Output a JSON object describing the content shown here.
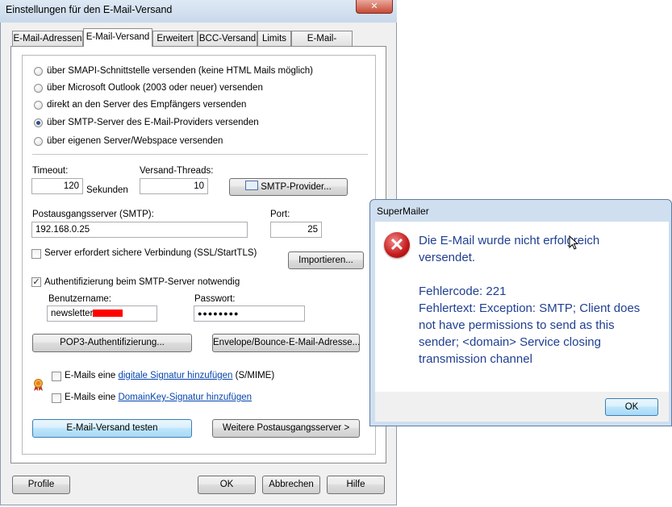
{
  "window": {
    "title": "Einstellungen für den E-Mail-Versand",
    "close_label": "✕"
  },
  "tabs": [
    {
      "label": "E-Mail-Adressen"
    },
    {
      "label": "E-Mail-Versand"
    },
    {
      "label": "Erweitert"
    },
    {
      "label": "BCC-Versand"
    },
    {
      "label": "Limits"
    },
    {
      "label": "E-Mail-Header"
    }
  ],
  "send_methods": [
    {
      "label": "über SMAPI-Schnittstelle versenden (keine HTML Mails möglich)",
      "selected": false
    },
    {
      "label": "über Microsoft Outlook (2003 oder neuer) versenden",
      "selected": false
    },
    {
      "label": "direkt an den Server des Empfängers versenden",
      "selected": false
    },
    {
      "label": "über SMTP-Server des E-Mail-Providers versenden",
      "selected": true
    },
    {
      "label": "über eigenen Server/Webspace versenden",
      "selected": false
    }
  ],
  "timeout": {
    "label": "Timeout:",
    "value": "120",
    "unit": "Sekunden"
  },
  "threads": {
    "label": "Versand-Threads:",
    "value": "10"
  },
  "smtp_provider_button": "SMTP-Provider...",
  "smtp_server": {
    "label": "Postausgangsserver (SMTP):",
    "value": "192.168.0.25"
  },
  "port": {
    "label": "Port:",
    "value": "25"
  },
  "secure_connection": {
    "label": "Server erfordert sichere Verbindung (SSL/StartTLS)",
    "checked": false
  },
  "import_button": "Importieren...",
  "auth": {
    "label": "Authentifizierung beim SMTP-Server notwendig",
    "checked": true,
    "check_glyph": "✓"
  },
  "username": {
    "label": "Benutzername:",
    "value": "newsletter"
  },
  "password": {
    "label": "Passwort:",
    "value": "●●●●●●●●"
  },
  "pop3_button": "POP3-Authentifizierung...",
  "envelope_button": "Envelope/Bounce-E-Mail-Adresse...",
  "signature": {
    "prefix": "E-Mails eine",
    "link": "digitale Signatur hinzufügen",
    "suffix": "(S/MIME)"
  },
  "domainkey": {
    "prefix": "E-Mails eine",
    "link": "DomainKey-Signatur hinzufügen"
  },
  "test_button": "E-Mail-Versand testen",
  "more_servers_button": "Weitere Postausgangsserver >",
  "footer": {
    "profile": "Profile",
    "ok": "OK",
    "cancel": "Abbrechen",
    "help": "Hilfe"
  },
  "message_box": {
    "title": "SuperMailer",
    "icon_glyph": "✕",
    "lines": [
      "Die E-Mail wurde nicht erfolgreich",
      "versendet.",
      "Fehlercode: 221",
      "Fehlertext: Exception: SMTP; Client does",
      "not have permissions to send as this",
      "sender; <domain> Service closing",
      "transmission channel"
    ],
    "ok": "OK"
  },
  "colors": {
    "message_text": "#1f3f91",
    "error_icon": "#c41a1a",
    "redaction": "#ff0000",
    "link": "#0645ad"
  }
}
